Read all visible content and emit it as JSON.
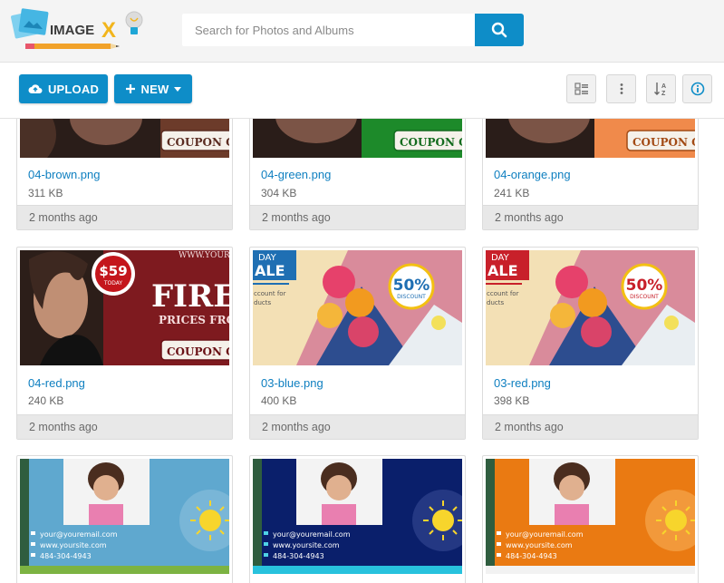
{
  "header": {
    "logo_text": "IMAGE X",
    "search": {
      "placeholder": "Search for Photos and Albums"
    }
  },
  "toolbar": {
    "upload_label": "UPLOAD",
    "new_label": "NEW",
    "icons": [
      "grid-view-icon",
      "more-vertical-icon",
      "sort-az-icon",
      "info-icon"
    ]
  },
  "colors": {
    "accent": "#0e8dc8",
    "link": "#0e7fc0"
  },
  "files": [
    {
      "name": "04-brown.png",
      "size": "311 KB",
      "age": "2 months ago",
      "banner_text": "COUPON CODE"
    },
    {
      "name": "04-green.png",
      "size": "304 KB",
      "age": "2 months ago",
      "banner_text": "COUPON CODE"
    },
    {
      "name": "04-orange.png",
      "size": "241 KB",
      "age": "2 months ago",
      "banner_text": "COUPON CODE"
    },
    {
      "name": "04-red.png",
      "size": "240 KB",
      "age": "2 months ago",
      "price": "$59",
      "today": "TODAY",
      "site": "WWW.YOURS",
      "headline": "FIRES",
      "sub": "PRICES FROM",
      "banner_text": "COUPON CODE"
    },
    {
      "name": "03-blue.png",
      "size": "400 KB",
      "age": "2 months ago",
      "day": "DAY",
      "sale": "ALE",
      "discount_pct": "50%",
      "discount": "DISCOUNT",
      "count1": "ccount for",
      "count2": "ducts"
    },
    {
      "name": "03-red.png",
      "size": "398 KB",
      "age": "2 months ago",
      "day": "DAY",
      "sale": "ALE",
      "discount_pct": "50%",
      "discount": "DISCOUNT",
      "count1": "ccount for",
      "count2": "ducts"
    },
    {
      "email": "your@youremail.com",
      "site": "www.yoursite.com",
      "phone": "484-304-4943"
    },
    {
      "email": "your@youremail.com",
      "site": "www.yoursite.com",
      "phone": "484-304-4943"
    },
    {
      "email": "your@youremail.com",
      "site": "www.yoursite.com",
      "phone": "484-304-4943"
    }
  ]
}
